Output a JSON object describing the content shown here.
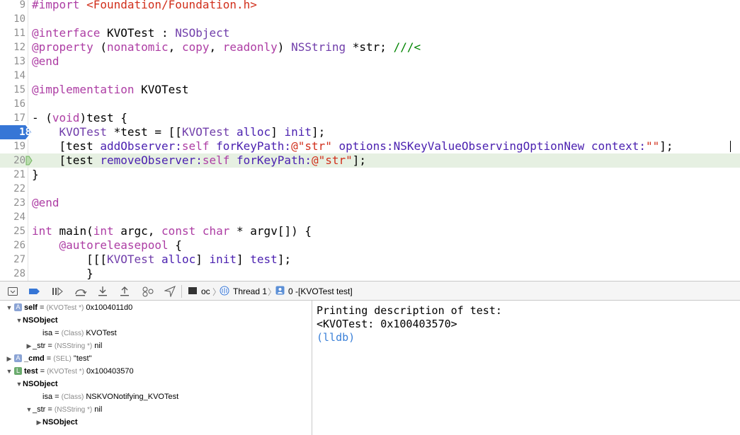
{
  "editor": {
    "lines": [
      {
        "num": "9",
        "segs": [
          {
            "t": "#import ",
            "c": "kw"
          },
          {
            "t": "<Foundation/Foundation.h>",
            "c": "str"
          }
        ]
      },
      {
        "num": "10",
        "segs": []
      },
      {
        "num": "11",
        "segs": [
          {
            "t": "@interface",
            "c": "kw"
          },
          {
            "t": " KVOTest : ",
            "c": ""
          },
          {
            "t": "NSObject",
            "c": "cls"
          }
        ]
      },
      {
        "num": "12",
        "segs": [
          {
            "t": "@property",
            "c": "kw"
          },
          {
            "t": " (",
            "c": ""
          },
          {
            "t": "nonatomic",
            "c": "kw"
          },
          {
            "t": ", ",
            "c": ""
          },
          {
            "t": "copy",
            "c": "kw"
          },
          {
            "t": ", ",
            "c": ""
          },
          {
            "t": "readonly",
            "c": "kw"
          },
          {
            "t": ") ",
            "c": ""
          },
          {
            "t": "NSString",
            "c": "cls"
          },
          {
            "t": " *str; ",
            "c": ""
          },
          {
            "t": "///<",
            "c": "cmt"
          }
        ]
      },
      {
        "num": "13",
        "segs": [
          {
            "t": "@end",
            "c": "kw"
          }
        ]
      },
      {
        "num": "14",
        "segs": []
      },
      {
        "num": "15",
        "segs": [
          {
            "t": "@implementation",
            "c": "kw"
          },
          {
            "t": " KVOTest",
            "c": ""
          }
        ]
      },
      {
        "num": "16",
        "segs": []
      },
      {
        "num": "17",
        "segs": [
          {
            "t": "- (",
            "c": ""
          },
          {
            "t": "void",
            "c": "kw"
          },
          {
            "t": ")test {",
            "c": ""
          }
        ]
      },
      {
        "num": "18",
        "bp": true,
        "segs": [
          {
            "t": "    ",
            "c": ""
          },
          {
            "t": "KVOTest",
            "c": "cls"
          },
          {
            "t": " *test = [[",
            "c": ""
          },
          {
            "t": "KVOTest",
            "c": "cls"
          },
          {
            "t": " ",
            "c": ""
          },
          {
            "t": "alloc",
            "c": "mth"
          },
          {
            "t": "] ",
            "c": ""
          },
          {
            "t": "init",
            "c": "mth"
          },
          {
            "t": "];",
            "c": ""
          }
        ]
      },
      {
        "num": "19",
        "caret": true,
        "segs": [
          {
            "t": "    [test ",
            "c": ""
          },
          {
            "t": "addObserver:",
            "c": "mth"
          },
          {
            "t": "self",
            "c": "kw"
          },
          {
            "t": " ",
            "c": ""
          },
          {
            "t": "forKeyPath:",
            "c": "mth"
          },
          {
            "t": "@\"str\"",
            "c": "str"
          },
          {
            "t": " ",
            "c": ""
          },
          {
            "t": "options:",
            "c": "mth"
          },
          {
            "t": "NSKeyValueObservingOptionNew",
            "c": "mth"
          },
          {
            "t": " ",
            "c": ""
          },
          {
            "t": "context:",
            "c": "mth"
          },
          {
            "t": "\"\"",
            "c": "str"
          },
          {
            "t": "];",
            "c": ""
          }
        ]
      },
      {
        "num": "20",
        "hl": true,
        "segs": [
          {
            "t": "    [test ",
            "c": ""
          },
          {
            "t": "removeObserver:",
            "c": "mth"
          },
          {
            "t": "self",
            "c": "kw"
          },
          {
            "t": " ",
            "c": ""
          },
          {
            "t": "forKeyPath:",
            "c": "mth"
          },
          {
            "t": "@\"str\"",
            "c": "str"
          },
          {
            "t": "];",
            "c": ""
          }
        ]
      },
      {
        "num": "21",
        "segs": [
          {
            "t": "}",
            "c": ""
          }
        ]
      },
      {
        "num": "22",
        "segs": []
      },
      {
        "num": "23",
        "segs": [
          {
            "t": "@end",
            "c": "kw"
          }
        ]
      },
      {
        "num": "24",
        "segs": []
      },
      {
        "num": "25",
        "segs": [
          {
            "t": "int",
            "c": "kw"
          },
          {
            "t": " main(",
            "c": ""
          },
          {
            "t": "int",
            "c": "kw"
          },
          {
            "t": " argc, ",
            "c": ""
          },
          {
            "t": "const",
            "c": "kw"
          },
          {
            "t": " ",
            "c": ""
          },
          {
            "t": "char",
            "c": "kw"
          },
          {
            "t": " * argv[]) {",
            "c": ""
          }
        ]
      },
      {
        "num": "26",
        "segs": [
          {
            "t": "    ",
            "c": ""
          },
          {
            "t": "@autoreleasepool",
            "c": "kw"
          },
          {
            "t": " {",
            "c": ""
          }
        ]
      },
      {
        "num": "27",
        "segs": [
          {
            "t": "        [[[",
            "c": ""
          },
          {
            "t": "KVOTest",
            "c": "cls"
          },
          {
            "t": " ",
            "c": ""
          },
          {
            "t": "alloc",
            "c": "mth"
          },
          {
            "t": "] ",
            "c": ""
          },
          {
            "t": "init",
            "c": "mth"
          },
          {
            "t": "] ",
            "c": ""
          },
          {
            "t": "test",
            "c": "mth"
          },
          {
            "t": "];",
            "c": ""
          }
        ]
      },
      {
        "num": "28",
        "segs": [
          {
            "t": "        }",
            "c": ""
          }
        ]
      }
    ]
  },
  "debug_bar": {
    "crumbs": {
      "target": "oc",
      "thread": "Thread 1",
      "frame": "0 -[KVOTest test]"
    }
  },
  "variables": [
    {
      "indent": 0,
      "tri": "down",
      "badge": "A",
      "badge_color": "#8aa3d4",
      "name": "self",
      "eq": " = ",
      "type": "(KVOTest *)",
      "value": " 0x1004011d0"
    },
    {
      "indent": 1,
      "tri": "down",
      "name": "NSObject"
    },
    {
      "indent": 3,
      "tri": "",
      "name": "isa",
      "eq": " = ",
      "type": "(Class)",
      "value": " KVOTest",
      "plain": true
    },
    {
      "indent": 2,
      "tri": "right",
      "name": "_str",
      "eq": " = ",
      "type": "(NSString *)",
      "value": " nil",
      "plain": true
    },
    {
      "indent": 0,
      "tri": "right",
      "badge": "A",
      "badge_color": "#8aa3d4",
      "name": "_cmd",
      "eq": " = ",
      "type": "(SEL)",
      "value": " \"test\""
    },
    {
      "indent": 0,
      "tri": "down",
      "badge": "L",
      "badge_color": "#6bab6e",
      "name": "test",
      "eq": " = ",
      "type": "(KVOTest *)",
      "value": " 0x100403570"
    },
    {
      "indent": 1,
      "tri": "down",
      "name": "NSObject"
    },
    {
      "indent": 3,
      "tri": "",
      "name": "isa",
      "eq": " = ",
      "type": "(Class)",
      "value": " NSKVONotifying_KVOTest",
      "plain": true
    },
    {
      "indent": 2,
      "tri": "down",
      "name": "_str",
      "eq": " = ",
      "type": "(NSString *)",
      "value": " nil",
      "plain": true
    },
    {
      "indent": 3,
      "tri": "right",
      "name": "NSObject"
    }
  ],
  "console": {
    "line1": "Printing description of test:",
    "line2": "<KVOTest: 0x100403570>",
    "prompt": "(lldb)"
  }
}
